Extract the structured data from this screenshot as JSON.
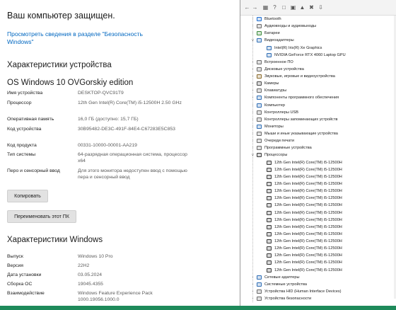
{
  "about": {
    "protected": "Ваш компьютер защищен.",
    "security_link": "Просмотреть сведения в разделе \"Безопасность Windows\"",
    "device_specs_title": "Характеристики устройства",
    "edition_display": "OS Windows 10 OVGorskiy edition",
    "device_rows": [
      {
        "k": "Имя устройства",
        "v": "DESKTOP-QVC91T9"
      },
      {
        "k": "Процессор",
        "v": "12th Gen Intel(R) Core(TM) i5-12500H 2.50 GHz"
      },
      {
        "k": "Оперативная память",
        "v": "16,0 ГБ (доступно: 15,7 ГБ)"
      },
      {
        "k": "Код устройства",
        "v": "30B95482-DE3C-491F-84E4-C67283E5C853"
      },
      {
        "k": "Код продукта",
        "v": "00331-10000-00001-AA219"
      },
      {
        "k": "Тип системы",
        "v": "64-разрядная операционная система, процессор x64"
      },
      {
        "k": "Перо и сенсорный ввод",
        "v": "Для этого монитора недоступен ввод с помощью пера и сенсорный ввод"
      }
    ],
    "copy_button": "Копировать",
    "rename_button": "Переименовать этот ПК",
    "win_specs_title": "Характеристики Windows",
    "win_rows": [
      {
        "k": "Выпуск",
        "v": "Windows 10 Pro"
      },
      {
        "k": "Версия",
        "v": "22H2"
      },
      {
        "k": "Дата установки",
        "v": "03.05.2024"
      },
      {
        "k": "Сборка ОС",
        "v": "19045.4355"
      },
      {
        "k": "Взаимодействие",
        "v": "Windows Feature Experience Pack 1000.19056.1000.0"
      }
    ]
  },
  "devmgr": {
    "toolbar_icons": [
      "back-arrow-icon",
      "forward-arrow-icon",
      "properties-icon",
      "help-icon",
      "scan-icon",
      "monitor-icon",
      "update-driver-icon",
      "uninstall-icon",
      "disable-icon"
    ],
    "items": [
      {
        "label": "Bluetooth",
        "level": 0,
        "state": "collapsed",
        "color": "#1f6fd1"
      },
      {
        "label": "Аудиовходы и аудиовыходы",
        "level": 0,
        "state": "collapsed",
        "color": "#6b6b6b"
      },
      {
        "label": "Батареи",
        "level": 0,
        "state": "collapsed",
        "color": "#3a8a3a"
      },
      {
        "label": "Видеоадаптеры",
        "level": 0,
        "state": "expanded",
        "color": "#2e6db5"
      },
      {
        "label": "Intel(R) Iris(R) Xe Graphics",
        "level": 1,
        "state": "none",
        "color": "#2e6db5"
      },
      {
        "label": "NVIDIA GeForce RTX 4060 Laptop GPU",
        "level": 1,
        "state": "none",
        "color": "#2e6db5"
      },
      {
        "label": "Встроенное ПО",
        "level": 0,
        "state": "collapsed",
        "color": "#6b6b6b"
      },
      {
        "label": "Дисковые устройства",
        "level": 0,
        "state": "collapsed",
        "color": "#6b6b6b"
      },
      {
        "label": "Звуковые, игровые и видеоустройства",
        "level": 0,
        "state": "collapsed",
        "color": "#8a6a2a"
      },
      {
        "label": "Камеры",
        "level": 0,
        "state": "collapsed",
        "color": "#4a4a4a"
      },
      {
        "label": "Клавиатуры",
        "level": 0,
        "state": "collapsed",
        "color": "#6b6b6b"
      },
      {
        "label": "Компоненты программного обеспечения",
        "level": 0,
        "state": "collapsed",
        "color": "#2e6db5"
      },
      {
        "label": "Компьютер",
        "level": 0,
        "state": "collapsed",
        "color": "#2e6db5"
      },
      {
        "label": "Контроллеры USB",
        "level": 0,
        "state": "collapsed",
        "color": "#6b6b6b"
      },
      {
        "label": "Контроллеры запоминающих устройств",
        "level": 0,
        "state": "collapsed",
        "color": "#6b6b6b"
      },
      {
        "label": "Мониторы",
        "level": 0,
        "state": "collapsed",
        "color": "#2e6db5"
      },
      {
        "label": "Мыши и иные указывающие устройства",
        "level": 0,
        "state": "collapsed",
        "color": "#6b6b6b"
      },
      {
        "label": "Очереди печати",
        "level": 0,
        "state": "collapsed",
        "color": "#6b6b6b"
      },
      {
        "label": "Программные устройства",
        "level": 0,
        "state": "collapsed",
        "color": "#6b6b6b"
      },
      {
        "label": "Процессоры",
        "level": 0,
        "state": "expanded",
        "color": "#3a3a3a"
      },
      {
        "label": "12th Gen Intel(R) Core(TM) i5-12500H",
        "level": 1,
        "state": "none",
        "color": "#3a3a3a"
      },
      {
        "label": "12th Gen Intel(R) Core(TM) i5-12500H",
        "level": 1,
        "state": "none",
        "color": "#3a3a3a"
      },
      {
        "label": "12th Gen Intel(R) Core(TM) i5-12500H",
        "level": 1,
        "state": "none",
        "color": "#3a3a3a"
      },
      {
        "label": "12th Gen Intel(R) Core(TM) i5-12500H",
        "level": 1,
        "state": "none",
        "color": "#3a3a3a"
      },
      {
        "label": "12th Gen Intel(R) Core(TM) i5-12500H",
        "level": 1,
        "state": "none",
        "color": "#3a3a3a"
      },
      {
        "label": "12th Gen Intel(R) Core(TM) i5-12500H",
        "level": 1,
        "state": "none",
        "color": "#3a3a3a"
      },
      {
        "label": "12th Gen Intel(R) Core(TM) i5-12500H",
        "level": 1,
        "state": "none",
        "color": "#3a3a3a"
      },
      {
        "label": "12th Gen Intel(R) Core(TM) i5-12500H",
        "level": 1,
        "state": "none",
        "color": "#3a3a3a"
      },
      {
        "label": "12th Gen Intel(R) Core(TM) i5-12500H",
        "level": 1,
        "state": "none",
        "color": "#3a3a3a"
      },
      {
        "label": "12th Gen Intel(R) Core(TM) i5-12500H",
        "level": 1,
        "state": "none",
        "color": "#3a3a3a"
      },
      {
        "label": "12th Gen Intel(R) Core(TM) i5-12500H",
        "level": 1,
        "state": "none",
        "color": "#3a3a3a"
      },
      {
        "label": "12th Gen Intel(R) Core(TM) i5-12500H",
        "level": 1,
        "state": "none",
        "color": "#3a3a3a"
      },
      {
        "label": "12th Gen Intel(R) Core(TM) i5-12500H",
        "level": 1,
        "state": "none",
        "color": "#3a3a3a"
      },
      {
        "label": "12th Gen Intel(R) Core(TM) i5-12500H",
        "level": 1,
        "state": "none",
        "color": "#3a3a3a"
      },
      {
        "label": "12th Gen Intel(R) Core(TM) i5-12500H",
        "level": 1,
        "state": "none",
        "color": "#3a3a3a"
      },
      {
        "label": "12th Gen Intel(R) Core(TM) i5-12500H",
        "level": 1,
        "state": "none",
        "color": "#3a3a3a"
      },
      {
        "label": "Сетевые адаптеры",
        "level": 0,
        "state": "collapsed",
        "color": "#2e6db5"
      },
      {
        "label": "Системные устройства",
        "level": 0,
        "state": "collapsed",
        "color": "#2e6db5"
      },
      {
        "label": "Устройства HID (Human Interface Devices)",
        "level": 0,
        "state": "collapsed",
        "color": "#6b6b6b"
      },
      {
        "label": "Устройства безопасности",
        "level": 0,
        "state": "collapsed",
        "color": "#6b6b6b"
      }
    ]
  },
  "colors": {
    "link": "#0067c0",
    "bottom_strip": "#1e8a5a"
  }
}
